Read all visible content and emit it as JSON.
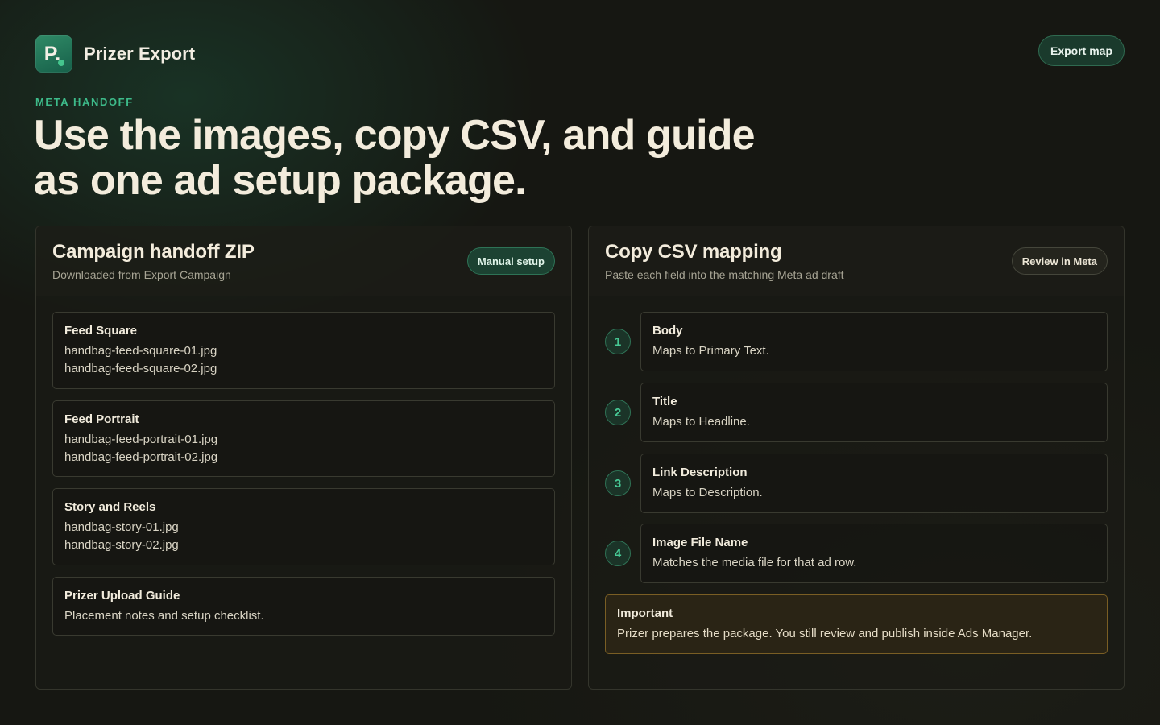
{
  "app": {
    "name": "Prizer Export",
    "logo_letter": "P."
  },
  "header": {
    "export_map_label": "Export map"
  },
  "hero": {
    "eyebrow": "META HANDOFF",
    "headline": "Use the images, copy CSV, and guide as one ad setup package."
  },
  "zip_panel": {
    "title": "Campaign handoff ZIP",
    "subtitle": "Downloaded from Export Campaign",
    "badge": "Manual setup",
    "groups": [
      {
        "title": "Feed Square",
        "lines": [
          "handbag-feed-square-01.jpg",
          "handbag-feed-square-02.jpg"
        ]
      },
      {
        "title": "Feed Portrait",
        "lines": [
          "handbag-feed-portrait-01.jpg",
          "handbag-feed-portrait-02.jpg"
        ]
      },
      {
        "title": "Story and Reels",
        "lines": [
          "handbag-story-01.jpg",
          "handbag-story-02.jpg"
        ]
      },
      {
        "title": "Prizer Upload Guide",
        "lines": [
          "Placement notes and setup checklist."
        ]
      }
    ]
  },
  "csv_panel": {
    "title": "Copy CSV mapping",
    "subtitle": "Paste each field into the matching Meta ad draft",
    "badge": "Review in Meta",
    "steps": [
      {
        "number": "1",
        "field": "Body",
        "description": "Maps to Primary Text."
      },
      {
        "number": "2",
        "field": "Title",
        "description": "Maps to Headline."
      },
      {
        "number": "3",
        "field": "Link Description",
        "description": "Maps to Description."
      },
      {
        "number": "4",
        "field": "Image File Name",
        "description": "Matches the media file for that ad row."
      }
    ],
    "note": {
      "title": "Important",
      "text": "Prizer prepares the package. You still review and publish inside Ads Manager."
    }
  },
  "colors": {
    "background": "#161712",
    "accent_green": "#3dbb8a",
    "warning_border": "#7a5e24"
  }
}
